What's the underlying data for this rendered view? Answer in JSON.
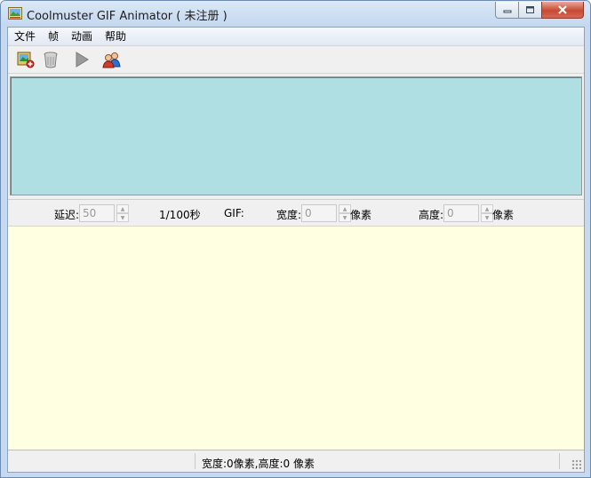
{
  "window": {
    "title": "Coolmuster GIF Animator ( 未注册 )"
  },
  "menu": {
    "items": [
      "文件",
      "帧",
      "动画",
      "帮助"
    ]
  },
  "toolbar": {
    "buttons": [
      "add-image-icon",
      "trash-icon",
      "play-icon",
      "users-icon"
    ]
  },
  "settings": {
    "delay_label": "延迟:",
    "delay_value": "50",
    "delay_unit": "1/100秒",
    "gif_label": "GIF:",
    "width_label": "宽度:",
    "width_value": "0",
    "width_unit": "像素",
    "height_label": "高度:",
    "height_value": "0",
    "height_unit": "像素"
  },
  "status": {
    "text": "宽度:0像素,高度:0 像素"
  },
  "colors": {
    "preview_bg": "#b0dfe3",
    "frames_bg": "#ffffe2"
  }
}
